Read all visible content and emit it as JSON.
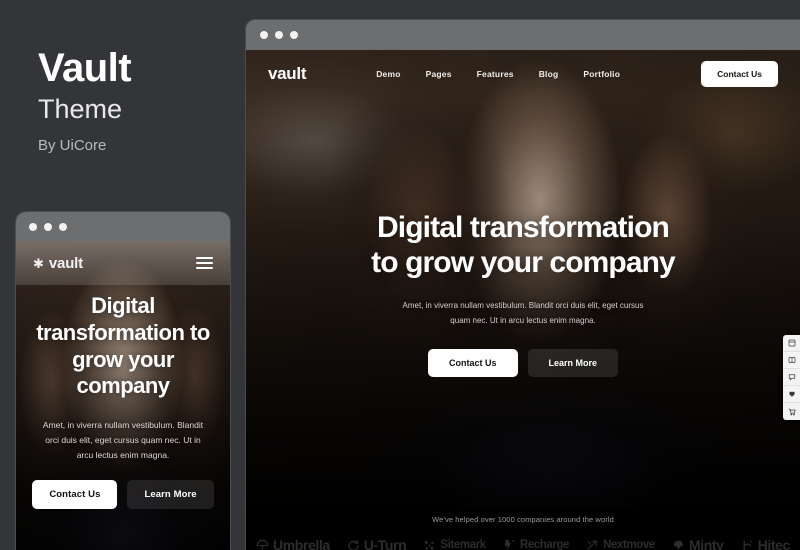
{
  "left_panel": {
    "title": "Vault",
    "subtitle": "Theme",
    "author": "By UiCore"
  },
  "mobile_preview": {
    "window_dots": 3,
    "logo_text": "vault",
    "logo_icon": "asterisk-icon",
    "menu_icon": "hamburger-menu-icon",
    "heading": "Digital transformation to grow your company",
    "paragraph": "Amet, in viverra nullam vestibulum. Blandit orci duis elit, eget cursus quam nec. Ut in arcu lectus enim magna.",
    "primary_button": "Contact Us",
    "secondary_button": "Learn More"
  },
  "desktop_preview": {
    "window_dots": 3,
    "logo_text": "vault",
    "nav_items": [
      {
        "label": "Demo"
      },
      {
        "label": "Pages"
      },
      {
        "label": "Features"
      },
      {
        "label": "Blog"
      },
      {
        "label": "Portfolio"
      }
    ],
    "nav_cta": "Contact Us",
    "heading_line1": "Digital transformation",
    "heading_line2": "to grow your company",
    "paragraph": "Amet, in viverra nullam vestibulum. Blandit orci duis elit, eget cursus quam nec. Ut in arcu lectus enim magna.",
    "primary_button": "Contact Us",
    "secondary_button": "Learn More",
    "side_toolbar": [
      {
        "icon": "page-layout-icon"
      },
      {
        "icon": "book-open-icon"
      },
      {
        "icon": "chat-bubble-icon"
      },
      {
        "icon": "heart-balloon-icon"
      },
      {
        "icon": "shopping-cart-icon"
      }
    ],
    "clients_caption": "We've helped over 1000 companies around the world",
    "client_logos": [
      {
        "name": "Umbrella",
        "icon": "umbrella-icon"
      },
      {
        "name": "U-Turn",
        "icon": "u-turn-arrow-icon"
      },
      {
        "name": "Sitemark",
        "icon": "sitemark-burst-icon"
      },
      {
        "name": "Recharge",
        "icon": "lightning-bolt-icon"
      },
      {
        "name": "Nextmove",
        "icon": "nextmove-arrow-icon"
      },
      {
        "name": "Minty",
        "icon": "mint-leaf-icon"
      },
      {
        "name": "Hitec",
        "icon": "hitec-icon"
      }
    ]
  },
  "colors": {
    "page_background": "#333538",
    "chrome_bar": "#6d6e70",
    "accent_white": "#ffffff",
    "logo_strip_background": "#000000"
  }
}
